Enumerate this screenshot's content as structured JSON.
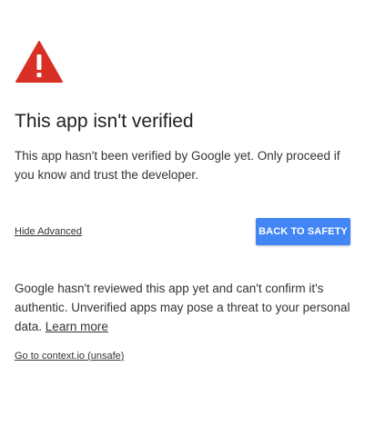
{
  "icon": {
    "name": "warning-triangle-icon",
    "color": "#d93025"
  },
  "page": {
    "title": "This app isn't verified",
    "description": "This app hasn't been verified by Google yet. Only proceed if you know and trust the developer."
  },
  "actions": {
    "hide_advanced_label": "Hide Advanced",
    "back_to_safety_label": "BACK TO SAFETY",
    "button_color": "#4285f4"
  },
  "advanced": {
    "details_text": "Google hasn't reviewed this app yet and can't confirm it's authentic. Unverified apps may pose a threat to your personal data.",
    "learn_more_label": "Learn more",
    "proceed_link_label": "Go to context.io (unsafe)"
  }
}
